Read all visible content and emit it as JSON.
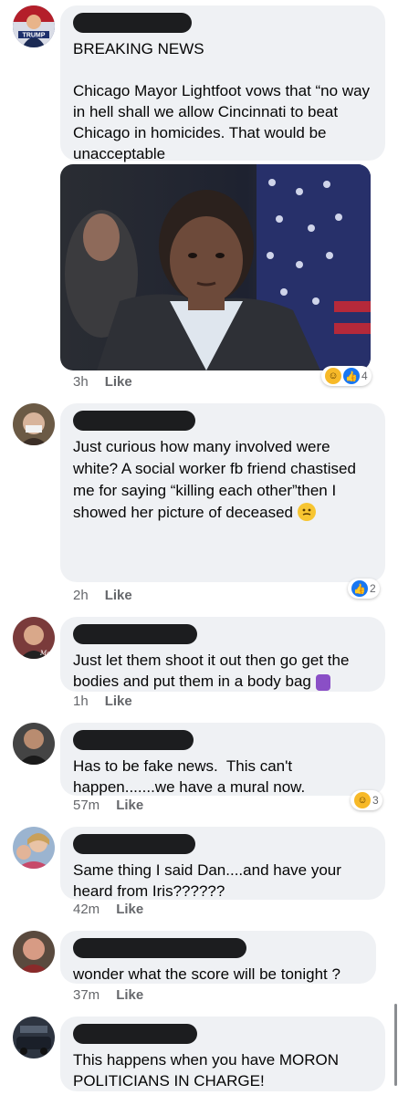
{
  "comments": [
    {
      "text": "BREAKING NEWS\n\nChicago Mayor Lightfoot vows that “no way in hell shall we allow Cincinnati to beat  Chicago in homicides. That would be unacceptable",
      "time": "3h",
      "like": "Like",
      "reaction_count": "4",
      "avatar_text": "TRUMP"
    },
    {
      "text": "Just curious how many involved were white? A social worker fb friend chastised me for saying “killing each other”then I showed her picture of deceased",
      "time": "2h",
      "like": "Like",
      "reaction_count": "2"
    },
    {
      "text": "Just let them shoot it out then go get the bodies and put them in a body bag",
      "time": "1h",
      "like": "Like"
    },
    {
      "text": "Has to be fake news.  This can't happen.......we have a mural now.",
      "time": "57m",
      "like": "Like",
      "reaction_count": "3"
    },
    {
      "text": "Same thing I said Dan....and have your heard from Iris??????",
      "time": "42m",
      "like": "Like"
    },
    {
      "text": "wonder what the score will be tonight ?",
      "time": "37m",
      "like": "Like"
    },
    {
      "text": "This happens when you have MORON POLITICIANS IN CHARGE!",
      "time": "",
      "like": ""
    }
  ],
  "colors": {
    "bubble": "#eff1f4",
    "meta": "#65676b",
    "like_blue": "#1877f2",
    "haha_yellow": "#f7b928"
  },
  "icons": {
    "haha": "haha-reaction-icon",
    "like": "like-reaction-icon",
    "grimace": "grimacing-emoji-icon",
    "bag": "purple-bag-emoji-icon"
  }
}
